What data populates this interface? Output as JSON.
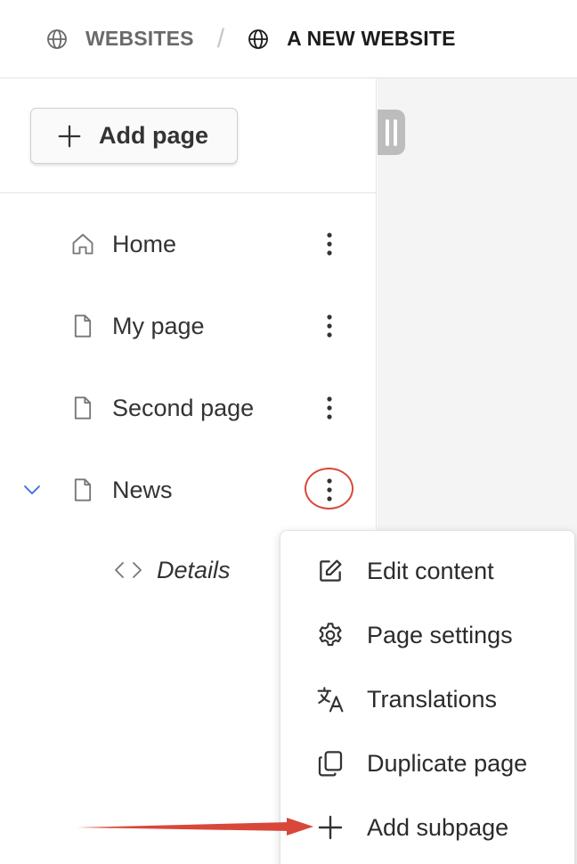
{
  "breadcrumb": {
    "items": [
      {
        "label": "WEBSITES",
        "icon": "globe-icon"
      },
      {
        "label": "A NEW WEBSITE",
        "icon": "globe-icon"
      }
    ],
    "separator": "/"
  },
  "sidebar": {
    "add_page_label": "Add page",
    "pages": [
      {
        "label": "Home",
        "icon": "home-icon"
      },
      {
        "label": "My page",
        "icon": "page-icon"
      },
      {
        "label": "Second page",
        "icon": "page-icon"
      },
      {
        "label": "News",
        "icon": "page-icon",
        "expanded": true
      }
    ],
    "details_label": "Details"
  },
  "context_menu": {
    "items": [
      {
        "label": "Edit content",
        "icon": "edit-icon"
      },
      {
        "label": "Page settings",
        "icon": "gear-icon"
      },
      {
        "label": "Translations",
        "icon": "translate-icon"
      },
      {
        "label": "Duplicate page",
        "icon": "duplicate-icon"
      },
      {
        "label": "Add subpage",
        "icon": "plus-icon"
      }
    ]
  },
  "colors": {
    "annotation_red": "#d9473a",
    "chevron_blue": "#2f6fe0"
  }
}
